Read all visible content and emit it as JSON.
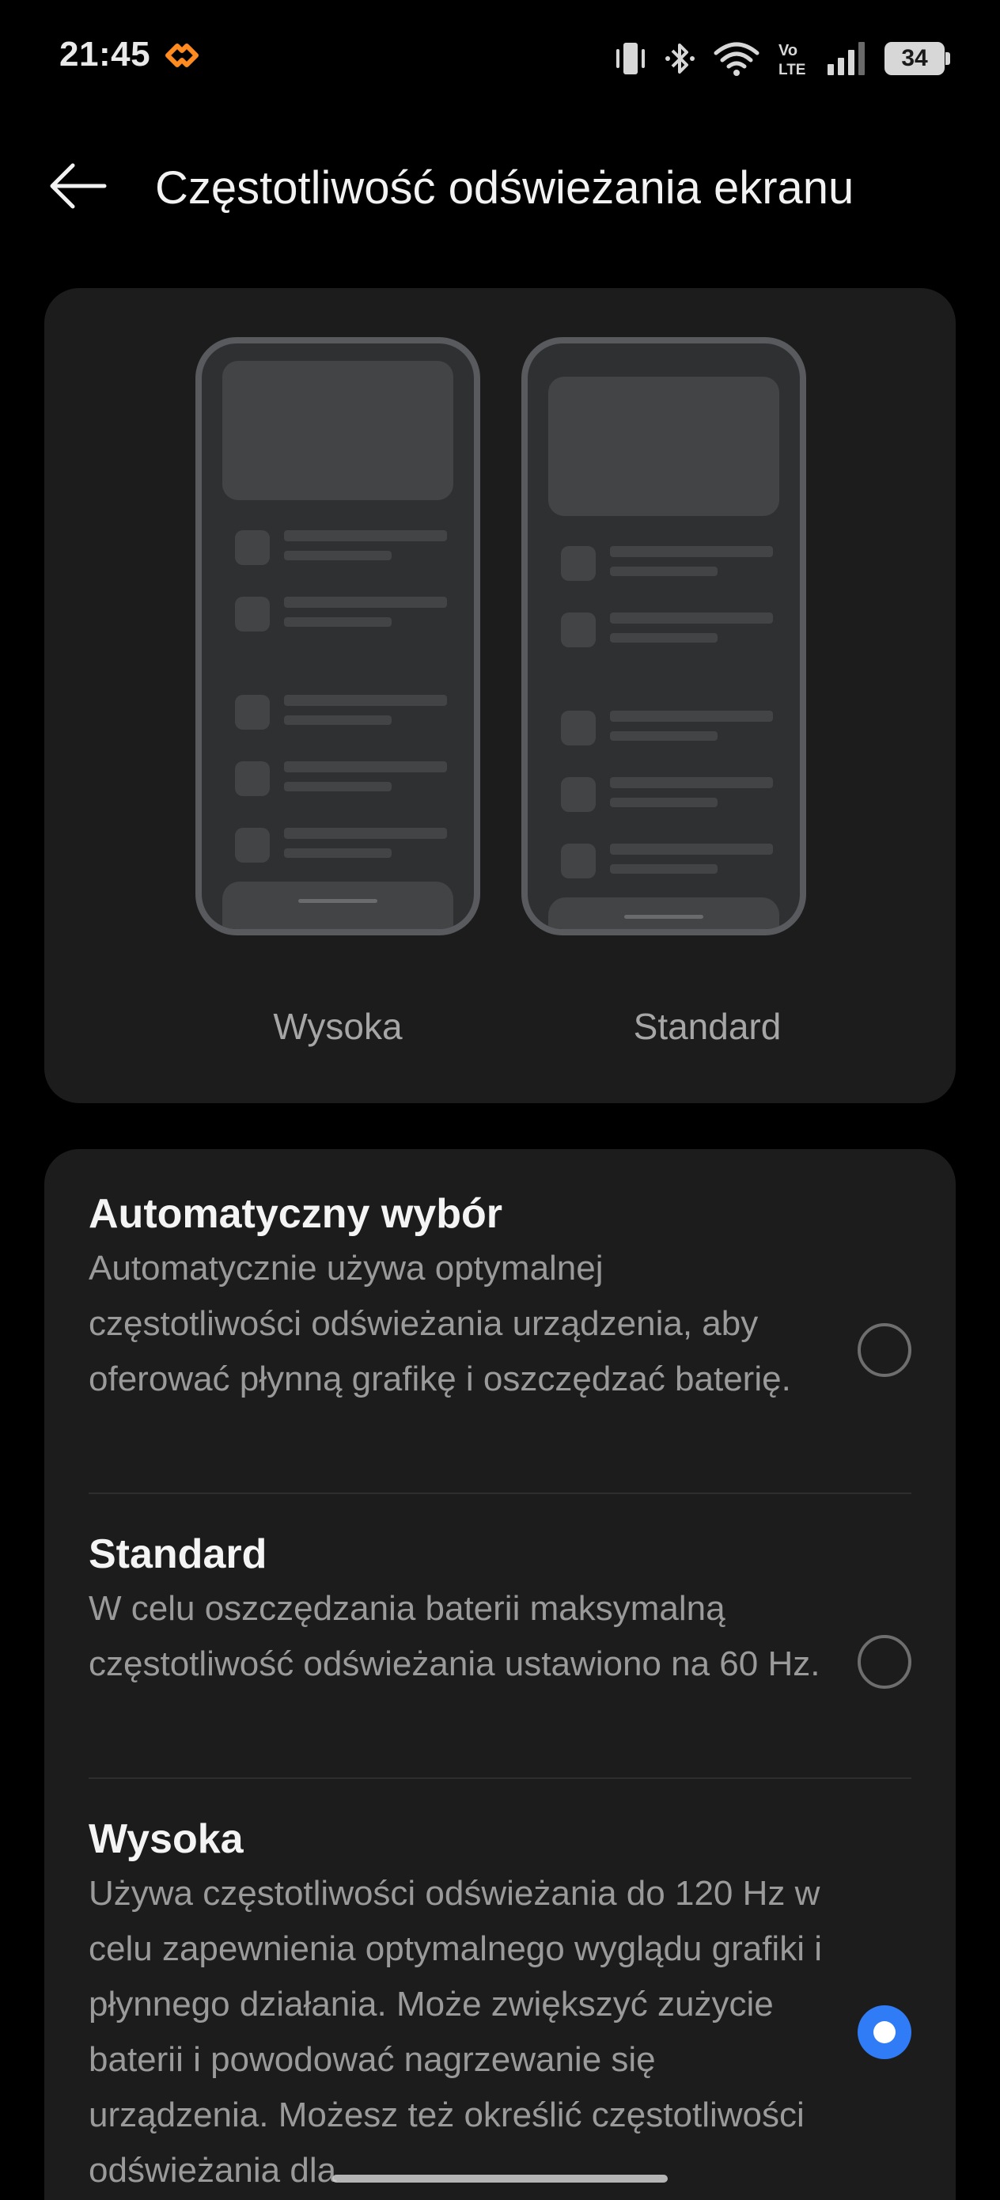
{
  "status_bar": {
    "time": "21:45",
    "battery": "34",
    "icons": [
      "app-notification-icon",
      "vibrate-icon",
      "bluetooth-icon",
      "wifi-icon",
      "volte-icon",
      "signal-icon",
      "battery-icon"
    ],
    "volte_top": "Vo",
    "volte_bottom": "LTE",
    "accent_color": "#ff8a1f"
  },
  "header": {
    "back_icon": "arrow-left-icon",
    "title": "Częstotliwość odświeżania ekranu"
  },
  "preview": {
    "high_label": "Wysoka",
    "standard_label": "Standard"
  },
  "options": [
    {
      "title": "Automatyczny wybór",
      "description": "Automatycznie używa optymalnej częstotliwości odświeżania urządzenia, aby oferować płynną grafikę i oszczędzać baterię.",
      "selected": false
    },
    {
      "title": "Standard",
      "description": "W celu oszczędzania baterii maksymalną częstotliwość odświeżania ustawiono na 60 Hz.",
      "selected": false
    },
    {
      "title": "Wysoka",
      "description": "Używa częstotliwości odświeżania do 120 Hz w celu zapewnienia optymalnego wyglądu grafiki i płynnego działania. Może zwiększyć zużycie baterii i powodować nagrzewanie się urządzenia. Możesz też określić częstotliwości odświeżania dla",
      "selected": true
    }
  ],
  "colors": {
    "background": "#000000",
    "card": "#1c1c1c",
    "radio_selected": "#2f7cf6"
  }
}
